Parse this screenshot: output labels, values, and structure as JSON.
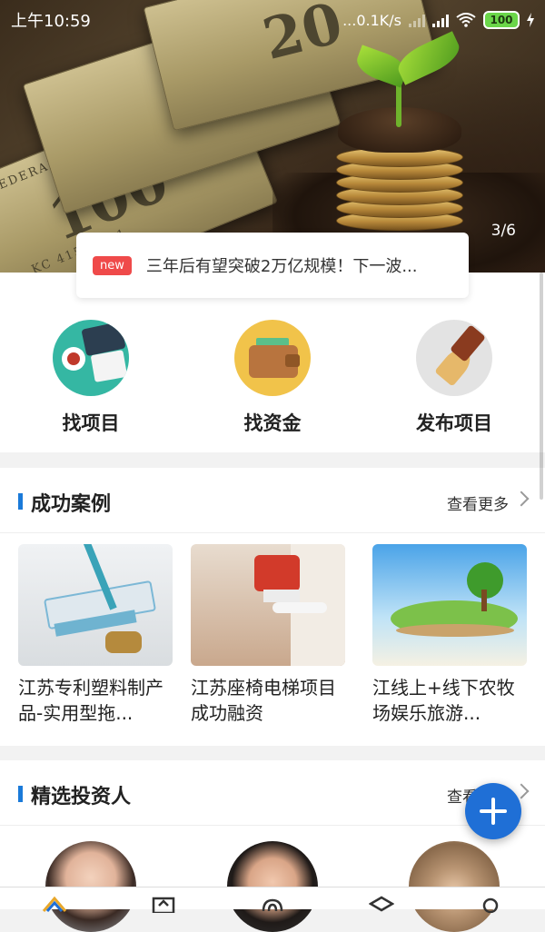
{
  "status_bar": {
    "time": "上午10:59",
    "network_speed": "...0.1K/s",
    "battery": "100"
  },
  "banner": {
    "pager": "3/6"
  },
  "news": {
    "badge": "new",
    "headline": "三年后有望突破2万亿规模！下一波..."
  },
  "quick_actions": [
    {
      "label": "找项目",
      "icon": "desk-icon"
    },
    {
      "label": "找资金",
      "icon": "wallet-icon"
    },
    {
      "label": "发布项目",
      "icon": "fountain-pen-icon"
    }
  ],
  "success_cases": {
    "title": "成功案例",
    "more": "查看更多",
    "items": [
      {
        "title": "江苏专利塑料制产品-实用型拖..."
      },
      {
        "title": "江苏座椅电梯项目成功融资"
      },
      {
        "title": "江线上+线下农牧场娱乐旅游..."
      }
    ]
  },
  "investors": {
    "title": "精选投资人",
    "more": "查看更多"
  },
  "colors": {
    "accent": "#1a7ad9",
    "badge": "#ef4a4a",
    "fab": "#1f6fd6"
  }
}
